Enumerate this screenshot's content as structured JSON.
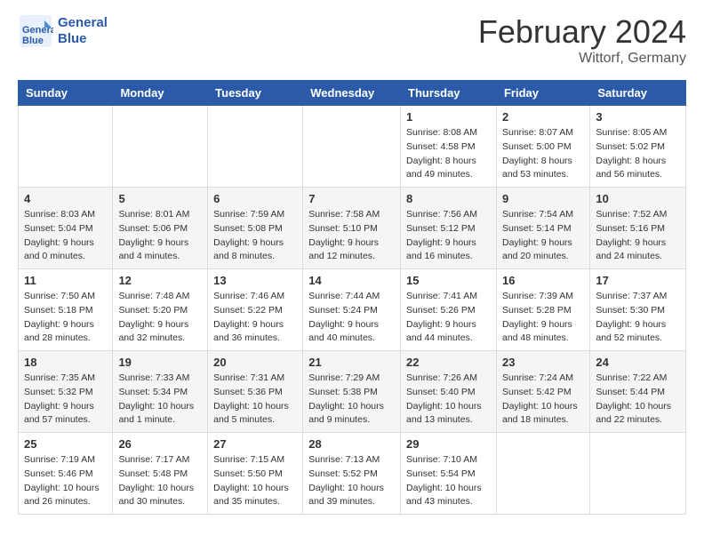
{
  "header": {
    "logo_line1": "General",
    "logo_line2": "Blue",
    "month_year": "February 2024",
    "location": "Wittorf, Germany"
  },
  "days_of_week": [
    "Sunday",
    "Monday",
    "Tuesday",
    "Wednesday",
    "Thursday",
    "Friday",
    "Saturday"
  ],
  "weeks": [
    [
      {
        "num": "",
        "info": ""
      },
      {
        "num": "",
        "info": ""
      },
      {
        "num": "",
        "info": ""
      },
      {
        "num": "",
        "info": ""
      },
      {
        "num": "1",
        "info": "Sunrise: 8:08 AM\nSunset: 4:58 PM\nDaylight: 8 hours\nand 49 minutes."
      },
      {
        "num": "2",
        "info": "Sunrise: 8:07 AM\nSunset: 5:00 PM\nDaylight: 8 hours\nand 53 minutes."
      },
      {
        "num": "3",
        "info": "Sunrise: 8:05 AM\nSunset: 5:02 PM\nDaylight: 8 hours\nand 56 minutes."
      }
    ],
    [
      {
        "num": "4",
        "info": "Sunrise: 8:03 AM\nSunset: 5:04 PM\nDaylight: 9 hours\nand 0 minutes."
      },
      {
        "num": "5",
        "info": "Sunrise: 8:01 AM\nSunset: 5:06 PM\nDaylight: 9 hours\nand 4 minutes."
      },
      {
        "num": "6",
        "info": "Sunrise: 7:59 AM\nSunset: 5:08 PM\nDaylight: 9 hours\nand 8 minutes."
      },
      {
        "num": "7",
        "info": "Sunrise: 7:58 AM\nSunset: 5:10 PM\nDaylight: 9 hours\nand 12 minutes."
      },
      {
        "num": "8",
        "info": "Sunrise: 7:56 AM\nSunset: 5:12 PM\nDaylight: 9 hours\nand 16 minutes."
      },
      {
        "num": "9",
        "info": "Sunrise: 7:54 AM\nSunset: 5:14 PM\nDaylight: 9 hours\nand 20 minutes."
      },
      {
        "num": "10",
        "info": "Sunrise: 7:52 AM\nSunset: 5:16 PM\nDaylight: 9 hours\nand 24 minutes."
      }
    ],
    [
      {
        "num": "11",
        "info": "Sunrise: 7:50 AM\nSunset: 5:18 PM\nDaylight: 9 hours\nand 28 minutes."
      },
      {
        "num": "12",
        "info": "Sunrise: 7:48 AM\nSunset: 5:20 PM\nDaylight: 9 hours\nand 32 minutes."
      },
      {
        "num": "13",
        "info": "Sunrise: 7:46 AM\nSunset: 5:22 PM\nDaylight: 9 hours\nand 36 minutes."
      },
      {
        "num": "14",
        "info": "Sunrise: 7:44 AM\nSunset: 5:24 PM\nDaylight: 9 hours\nand 40 minutes."
      },
      {
        "num": "15",
        "info": "Sunrise: 7:41 AM\nSunset: 5:26 PM\nDaylight: 9 hours\nand 44 minutes."
      },
      {
        "num": "16",
        "info": "Sunrise: 7:39 AM\nSunset: 5:28 PM\nDaylight: 9 hours\nand 48 minutes."
      },
      {
        "num": "17",
        "info": "Sunrise: 7:37 AM\nSunset: 5:30 PM\nDaylight: 9 hours\nand 52 minutes."
      }
    ],
    [
      {
        "num": "18",
        "info": "Sunrise: 7:35 AM\nSunset: 5:32 PM\nDaylight: 9 hours\nand 57 minutes."
      },
      {
        "num": "19",
        "info": "Sunrise: 7:33 AM\nSunset: 5:34 PM\nDaylight: 10 hours\nand 1 minute."
      },
      {
        "num": "20",
        "info": "Sunrise: 7:31 AM\nSunset: 5:36 PM\nDaylight: 10 hours\nand 5 minutes."
      },
      {
        "num": "21",
        "info": "Sunrise: 7:29 AM\nSunset: 5:38 PM\nDaylight: 10 hours\nand 9 minutes."
      },
      {
        "num": "22",
        "info": "Sunrise: 7:26 AM\nSunset: 5:40 PM\nDaylight: 10 hours\nand 13 minutes."
      },
      {
        "num": "23",
        "info": "Sunrise: 7:24 AM\nSunset: 5:42 PM\nDaylight: 10 hours\nand 18 minutes."
      },
      {
        "num": "24",
        "info": "Sunrise: 7:22 AM\nSunset: 5:44 PM\nDaylight: 10 hours\nand 22 minutes."
      }
    ],
    [
      {
        "num": "25",
        "info": "Sunrise: 7:19 AM\nSunset: 5:46 PM\nDaylight: 10 hours\nand 26 minutes."
      },
      {
        "num": "26",
        "info": "Sunrise: 7:17 AM\nSunset: 5:48 PM\nDaylight: 10 hours\nand 30 minutes."
      },
      {
        "num": "27",
        "info": "Sunrise: 7:15 AM\nSunset: 5:50 PM\nDaylight: 10 hours\nand 35 minutes."
      },
      {
        "num": "28",
        "info": "Sunrise: 7:13 AM\nSunset: 5:52 PM\nDaylight: 10 hours\nand 39 minutes."
      },
      {
        "num": "29",
        "info": "Sunrise: 7:10 AM\nSunset: 5:54 PM\nDaylight: 10 hours\nand 43 minutes."
      },
      {
        "num": "",
        "info": ""
      },
      {
        "num": "",
        "info": ""
      }
    ]
  ]
}
